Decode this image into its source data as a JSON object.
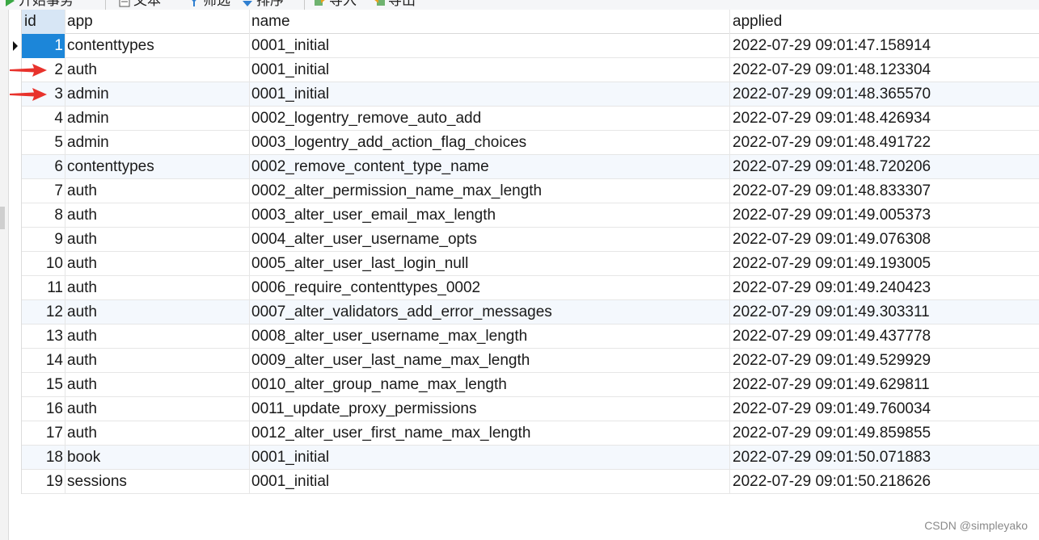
{
  "toolbar": {
    "items": [
      {
        "label": "开始事务",
        "icon": "play-icon"
      },
      {
        "label": "文本",
        "icon": "text-doc-icon"
      },
      {
        "label": "筛选",
        "icon": "filter-icon"
      },
      {
        "label": "排序",
        "icon": "sort-icon"
      },
      {
        "label": "导入",
        "icon": "import-icon"
      },
      {
        "label": "导出",
        "icon": "export-icon"
      }
    ]
  },
  "table": {
    "columns": [
      "id",
      "app",
      "name",
      "applied"
    ],
    "rows": [
      {
        "id": "1",
        "app": "contenttypes",
        "name": "0001_initial",
        "applied": "2022-07-29 09:01:47.158914"
      },
      {
        "id": "2",
        "app": "auth",
        "name": "0001_initial",
        "applied": "2022-07-29 09:01:48.123304"
      },
      {
        "id": "3",
        "app": "admin",
        "name": "0001_initial",
        "applied": "2022-07-29 09:01:48.365570"
      },
      {
        "id": "4",
        "app": "admin",
        "name": "0002_logentry_remove_auto_add",
        "applied": "2022-07-29 09:01:48.426934"
      },
      {
        "id": "5",
        "app": "admin",
        "name": "0003_logentry_add_action_flag_choices",
        "applied": "2022-07-29 09:01:48.491722"
      },
      {
        "id": "6",
        "app": "contenttypes",
        "name": "0002_remove_content_type_name",
        "applied": "2022-07-29 09:01:48.720206"
      },
      {
        "id": "7",
        "app": "auth",
        "name": "0002_alter_permission_name_max_length",
        "applied": "2022-07-29 09:01:48.833307"
      },
      {
        "id": "8",
        "app": "auth",
        "name": "0003_alter_user_email_max_length",
        "applied": "2022-07-29 09:01:49.005373"
      },
      {
        "id": "9",
        "app": "auth",
        "name": "0004_alter_user_username_opts",
        "applied": "2022-07-29 09:01:49.076308"
      },
      {
        "id": "10",
        "app": "auth",
        "name": "0005_alter_user_last_login_null",
        "applied": "2022-07-29 09:01:49.193005"
      },
      {
        "id": "11",
        "app": "auth",
        "name": "0006_require_contenttypes_0002",
        "applied": "2022-07-29 09:01:49.240423"
      },
      {
        "id": "12",
        "app": "auth",
        "name": "0007_alter_validators_add_error_messages",
        "applied": "2022-07-29 09:01:49.303311"
      },
      {
        "id": "13",
        "app": "auth",
        "name": "0008_alter_user_username_max_length",
        "applied": "2022-07-29 09:01:49.437778"
      },
      {
        "id": "14",
        "app": "auth",
        "name": "0009_alter_user_last_name_max_length",
        "applied": "2022-07-29 09:01:49.529929"
      },
      {
        "id": "15",
        "app": "auth",
        "name": "0010_alter_group_name_max_length",
        "applied": "2022-07-29 09:01:49.629811"
      },
      {
        "id": "16",
        "app": "auth",
        "name": "0011_update_proxy_permissions",
        "applied": "2022-07-29 09:01:49.760034"
      },
      {
        "id": "17",
        "app": "auth",
        "name": "0012_alter_user_first_name_max_length",
        "applied": "2022-07-29 09:01:49.859855"
      },
      {
        "id": "18",
        "app": "book",
        "name": "0001_initial",
        "applied": "2022-07-29 09:01:50.071883"
      },
      {
        "id": "19",
        "app": "sessions",
        "name": "0001_initial",
        "applied": "2022-07-29 09:01:50.218626"
      }
    ],
    "selected_row": 1,
    "alternate_rows": [
      3,
      6,
      12,
      18
    ],
    "annotated_rows": [
      2,
      3
    ],
    "selection_color": "#1c86d9",
    "arrow_color": "#e8322c"
  },
  "watermark": "CSDN @simpleyako"
}
